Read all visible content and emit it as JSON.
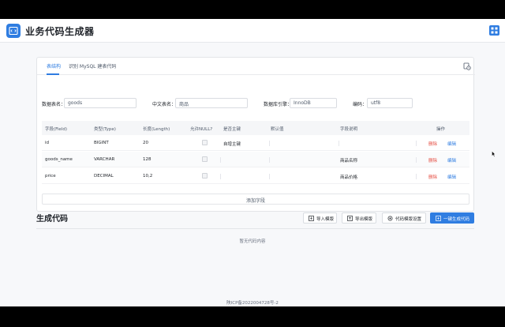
{
  "app": {
    "title": "业务代码生成器"
  },
  "tabs": [
    {
      "label": "表结构",
      "active": true
    },
    {
      "label": "识别 MySQL 建表代码",
      "active": false
    }
  ],
  "form": {
    "table_name_label": "数据表名：",
    "table_name_value": "goods",
    "cn_name_label": "中文表名：",
    "cn_name_value": "商品",
    "engine_label": "数据库引擎：",
    "engine_value": "InnoDB",
    "charset_label": "编码：",
    "charset_value": "utf8"
  },
  "table": {
    "headers": [
      "字段(Field)",
      "类型(Type)",
      "长度(Length)",
      "允许NULL?",
      "是否主键",
      "默认值",
      "字段说明",
      "操作"
    ],
    "rows": [
      {
        "field": "id",
        "type": "BIGINT",
        "length": "20",
        "pk": "自增主键",
        "default": "",
        "comment": ""
      },
      {
        "field": "goods_name",
        "type": "VARCHAR",
        "length": "128",
        "pk": "",
        "default": "",
        "comment": "商品名称"
      },
      {
        "field": "price",
        "type": "DECIMAL",
        "length": "10,2",
        "pk": "",
        "default": "",
        "comment": "商品价格"
      }
    ],
    "delete_label": "删除",
    "edit_label": "编辑",
    "add_field_label": "添加字段"
  },
  "generate": {
    "title": "生成代码",
    "import_label": "导入模版",
    "export_label": "导出模版",
    "settings_label": "代码模版设置",
    "generate_label": "一键生成代码",
    "empty_text": "暂无代码内容"
  },
  "footer": {
    "icp": "陕ICP备2022004728号-2"
  },
  "colors": {
    "accent": "#2f7de1",
    "danger": "#e54d42"
  }
}
